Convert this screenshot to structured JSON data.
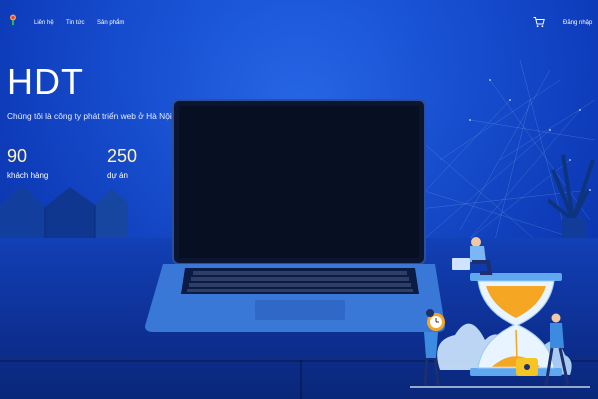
{
  "nav": {
    "logo_icon": "brand-logo-icon",
    "links": [
      "Liên hệ",
      "Tin tức",
      "Sản phẩm"
    ],
    "cart_icon": "shopping-cart-icon",
    "login_label": "Đăng nhập"
  },
  "hero": {
    "title": "HDT",
    "subtitle": "Chúng tôi là công ty phát triển web ở Hà Nội",
    "stats": [
      {
        "value": "90",
        "label": "khách hàng"
      },
      {
        "value": "250",
        "label": "dự án"
      }
    ]
  },
  "colors": {
    "background_blue": "#1a55d8",
    "stat_number": "#fff3c0",
    "accent_orange": "#f5a623"
  }
}
